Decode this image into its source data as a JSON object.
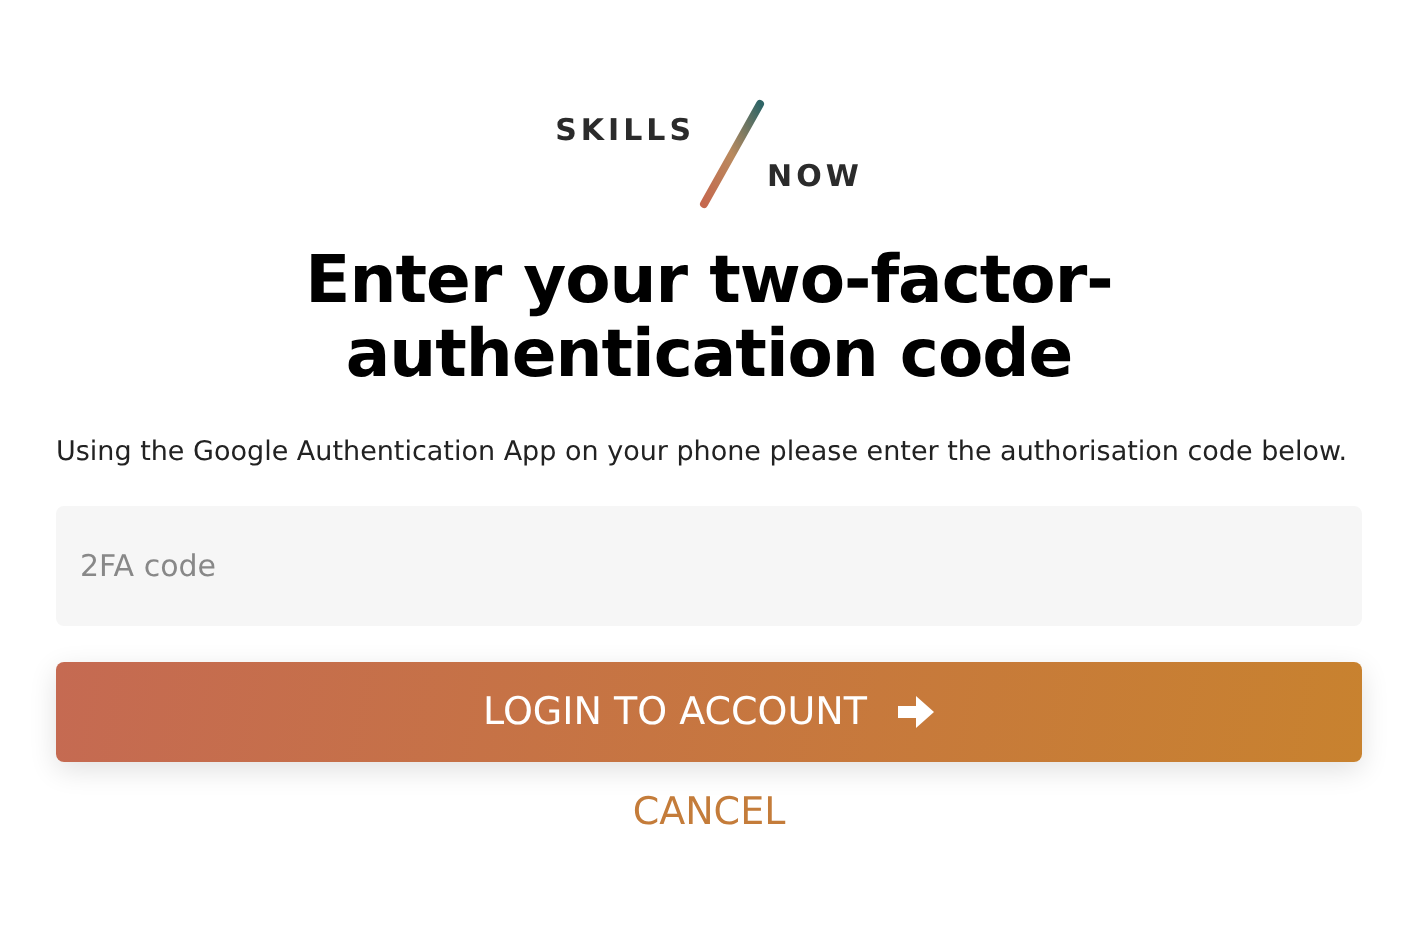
{
  "logo": {
    "top": "SKILLS",
    "bottom": "NOW"
  },
  "heading": "Enter your two-factor-authentication code",
  "instructions": "Using the Google Authentication App on your phone please enter the authorisation code below.",
  "code_field": {
    "placeholder": "2FA code"
  },
  "buttons": [
    {
      "kind": "primary",
      "label": "LOGIN TO ACCOUNT"
    },
    {
      "kind": "link",
      "label": "CANCEL"
    }
  ]
}
